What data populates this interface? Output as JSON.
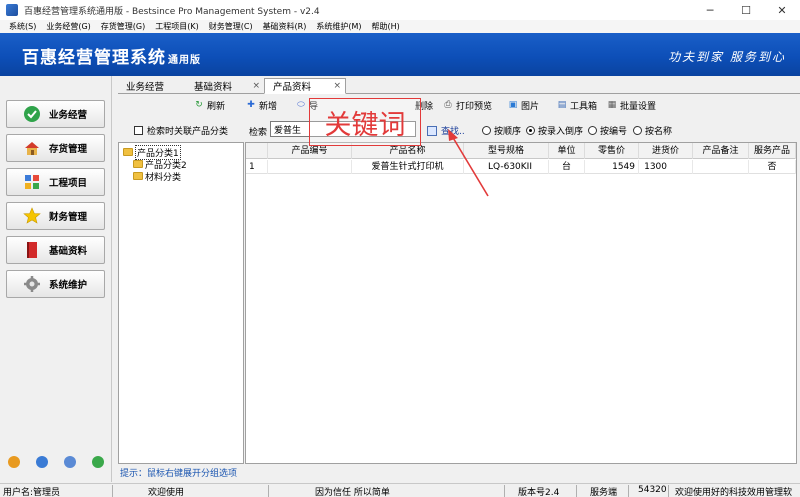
{
  "window": {
    "title": "百惠经营管理系统通用版 - Bestsince Pro Management System - v2.4"
  },
  "menu": [
    "系统(S)",
    "业务经营(G)",
    "存货管理(G)",
    "工程项目(K)",
    "财务管理(C)",
    "基础资料(R)",
    "系统维护(M)",
    "帮助(H)"
  ],
  "header": {
    "brand": "百惠经营管理系统",
    "edition": "通用版",
    "slogan": "功夫到家  服务到心"
  },
  "nav": [
    {
      "label": "业务经营",
      "icon": "check-circle-icon"
    },
    {
      "label": "存货管理",
      "icon": "house-icon"
    },
    {
      "label": "工程项目",
      "icon": "project-icon"
    },
    {
      "label": "财务管理",
      "icon": "star-icon"
    },
    {
      "label": "基础资料",
      "icon": "book-icon"
    },
    {
      "label": "系统维护",
      "icon": "gear-icon"
    }
  ],
  "tabs": [
    {
      "label": "业务经营",
      "closable": false,
      "active": false
    },
    {
      "label": "基础资料",
      "closable": true,
      "active": false
    },
    {
      "label": "产品资料",
      "closable": true,
      "active": true
    }
  ],
  "toolbar": {
    "refresh": "刷新",
    "add": "新增",
    "import": "导",
    "delete": "删除",
    "print_preview": "打印预览",
    "image": "图片",
    "toolbox": "工具箱",
    "batch_settings": "批量设置"
  },
  "tree": {
    "sync_label": "检索时关联产品分类",
    "nodes": [
      "产品分类1",
      "产品分类2",
      "材料分类"
    ]
  },
  "search": {
    "label": "检索",
    "value": "爱普生",
    "find_label": "查找..",
    "annotation": "关键词",
    "options": [
      {
        "label": "按顺序",
        "checked": false
      },
      {
        "label": "按录入倒序",
        "checked": true
      },
      {
        "label": "按编号",
        "checked": false
      },
      {
        "label": "按名称",
        "checked": false
      }
    ]
  },
  "grid": {
    "columns": [
      "",
      "产品编号",
      "产品名称",
      "型号规格",
      "单位",
      "零售价",
      "进货价",
      "产品备注",
      "服务产品"
    ],
    "rows": [
      [
        "1",
        "",
        "爱普生针式打印机",
        "LQ-630KII",
        "台",
        "1549",
        "1300",
        "",
        "否"
      ]
    ]
  },
  "hint": "提示：鼠标右键展开分组选项",
  "status": {
    "user": "用户名:管理员",
    "welcome": "欢迎使用",
    "motto": "因为信任 所以简单",
    "version": "版本号2.4",
    "service_label": "服务端",
    "service_port": "54320",
    "message": "欢迎使用好的科技效用管理软"
  },
  "colors": {
    "banner": "#0d4fb8",
    "annotation": "#e23a3a"
  }
}
